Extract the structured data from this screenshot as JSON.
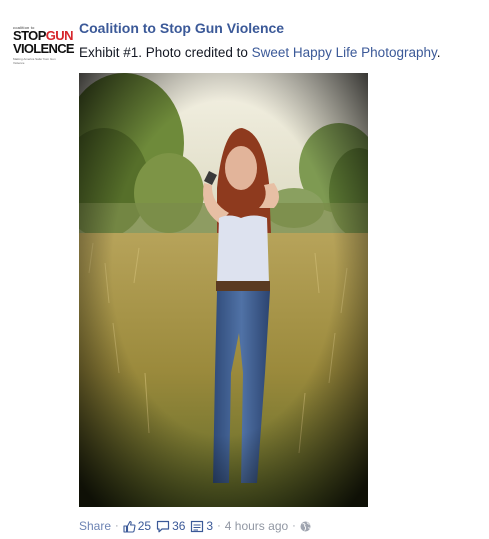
{
  "post": {
    "page_name": "Coalition to Stop Gun Violence",
    "caption_prefix": "Exhibit #1. Photo credited to ",
    "caption_link": "Sweet Happy Life Photography",
    "caption_suffix": "."
  },
  "avatar": {
    "small_text": "coalition to",
    "stop": "STOP",
    "gun": "GUN",
    "violence": "VIOLENCE",
    "tagline": "Making America Safer from Gun Violence",
    "icon": "coalition-logo"
  },
  "photo": {
    "subject": "woman-aiming-handgun-in-field"
  },
  "footer": {
    "share_label": "Share",
    "likes_count": "25",
    "comments_count": "36",
    "shares_count": "3",
    "timestamp": "4 hours ago",
    "separator": "·",
    "icons": [
      "thumbs-up-icon",
      "comment-icon",
      "share-icon",
      "globe-icon"
    ]
  },
  "colors": {
    "link": "#3b5998",
    "muted": "#9197a3",
    "brand_red": "#d6262c"
  }
}
